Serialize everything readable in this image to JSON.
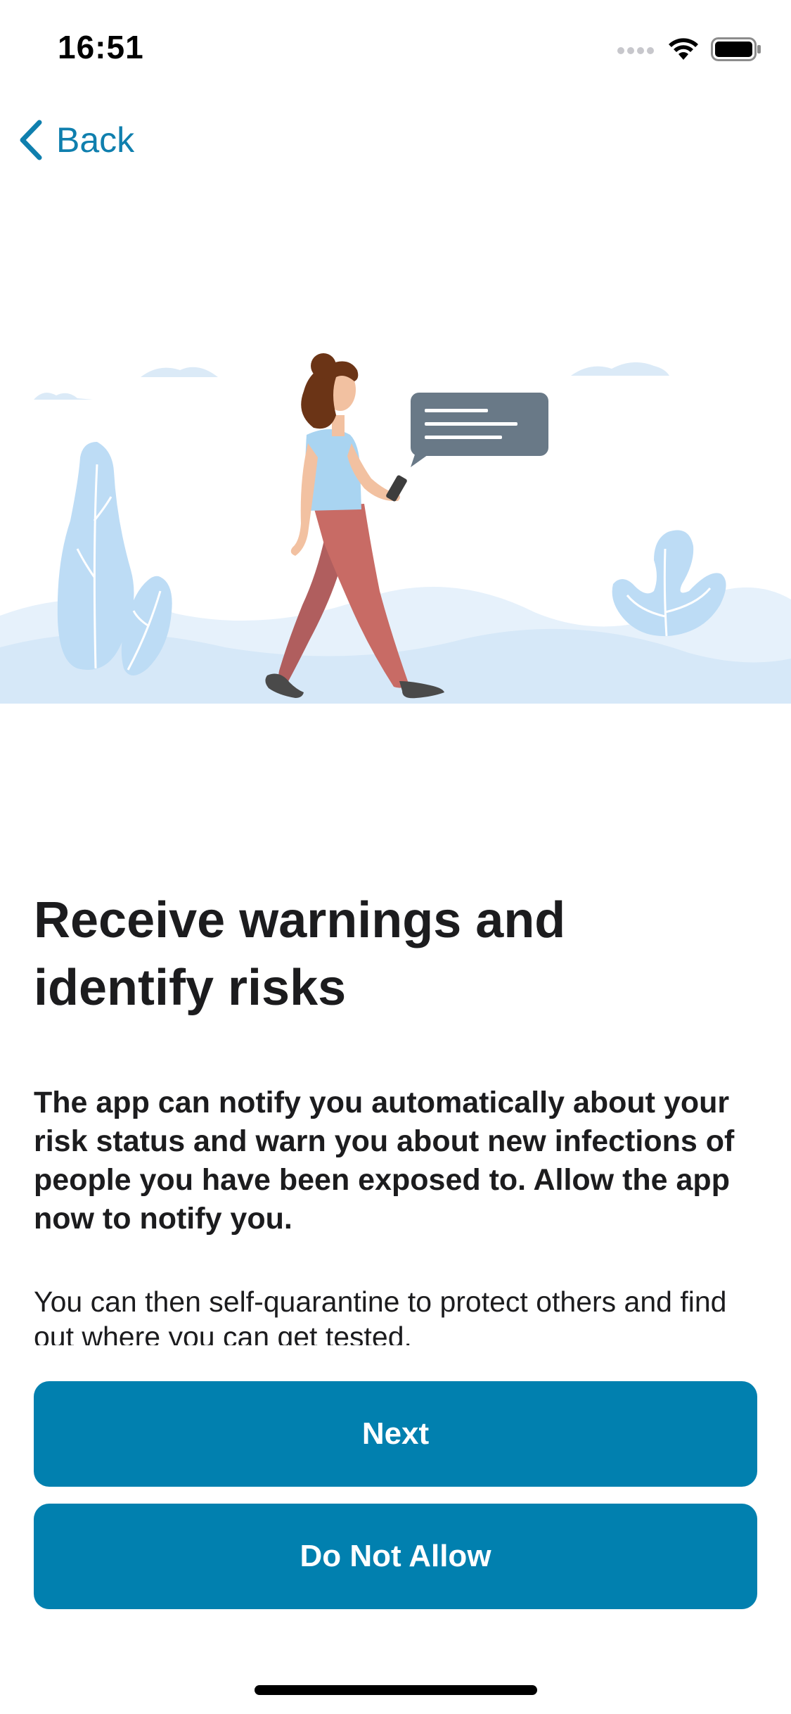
{
  "status_bar": {
    "time": "16:51",
    "icons": [
      "cellular-signal-icon",
      "wifi-icon",
      "battery-icon"
    ]
  },
  "nav": {
    "back_label": "Back",
    "icon": "chevron-left-icon"
  },
  "illustration": {
    "icon": "woman-walking-with-phone-illustration"
  },
  "content": {
    "title": "Receive warnings and identify risks",
    "intro": "The app can notify you automatically about your risk status and warn you about new infections of people you have been exposed to. Allow the app now to notify you.",
    "detail": "You can then self-quarantine to protect others and find out where you can get tested."
  },
  "actions": {
    "next_label": "Next",
    "deny_label": "Do Not Allow"
  },
  "colors": {
    "accent": "#0180af",
    "link": "#0f7fae",
    "text": "#1c1c1e",
    "background": "#ffffff"
  }
}
